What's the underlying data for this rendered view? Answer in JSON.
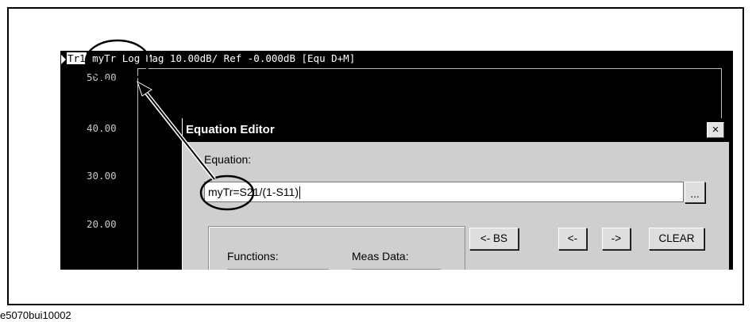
{
  "analyzer": {
    "trace_badge": "Tr1",
    "trace_header_rest": " myTr Log Mag 10.00dB/ Ref -0.000dB [Equ D+M]",
    "y_ticks": [
      "50.00",
      "40.00",
      "30.00",
      "20.00"
    ]
  },
  "dialog": {
    "title": "Equation Editor",
    "close_label": "×",
    "equation_label": "Equation:",
    "equation_value": "myTr=S21/(1-S11)",
    "ellipsis_label": "...",
    "functions_label": "Functions:",
    "meas_data_label": "Meas Data:",
    "buttons": {
      "backspace": "<- BS",
      "left": "<-",
      "right": "->",
      "clear": "CLEAR"
    }
  },
  "caption": "e5070bui10002"
}
